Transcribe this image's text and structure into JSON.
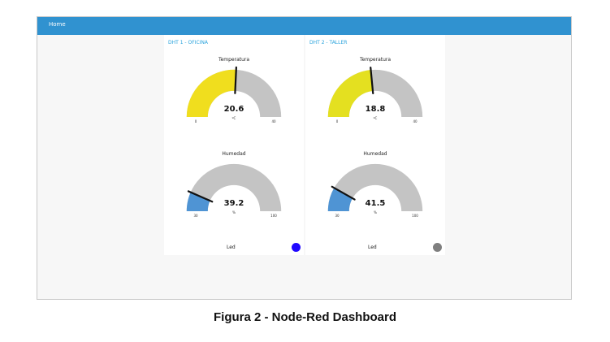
{
  "dashboard": {
    "header": {
      "title": "Home"
    },
    "groups": [
      {
        "title": "DHT 1 - OFICINA",
        "gauges": [
          {
            "title": "Temperatura",
            "value": 20.6,
            "value_label": "20.6",
            "unit": "ºC",
            "min": 0,
            "max": 40,
            "min_label": "0",
            "max_label": "40",
            "color": "#f0de1e"
          },
          {
            "title": "Humedad",
            "value": 39.2,
            "value_label": "39.2",
            "unit": "%",
            "min": 30,
            "max": 100,
            "min_label": "30",
            "max_label": "100",
            "color": "#4f94d4"
          }
        ],
        "led": {
          "label": "Led",
          "color": "#2008ff"
        }
      },
      {
        "title": "DHT 2 - TALLER",
        "gauges": [
          {
            "title": "Temperatura",
            "value": 18.8,
            "value_label": "18.8",
            "unit": "ºC",
            "min": 0,
            "max": 40,
            "min_label": "0",
            "max_label": "40",
            "color": "#e4e020"
          },
          {
            "title": "Humedad",
            "value": 41.5,
            "value_label": "41.5",
            "unit": "%",
            "min": 30,
            "max": 100,
            "min_label": "30",
            "max_label": "100",
            "color": "#4f94d4"
          }
        ],
        "led": {
          "label": "Led",
          "color": "#7f7f7f"
        }
      }
    ],
    "gauge_track_color": "#c4c4c4",
    "needle_color": "#111111"
  },
  "caption": "Figura 2 - Node-Red Dashboard"
}
